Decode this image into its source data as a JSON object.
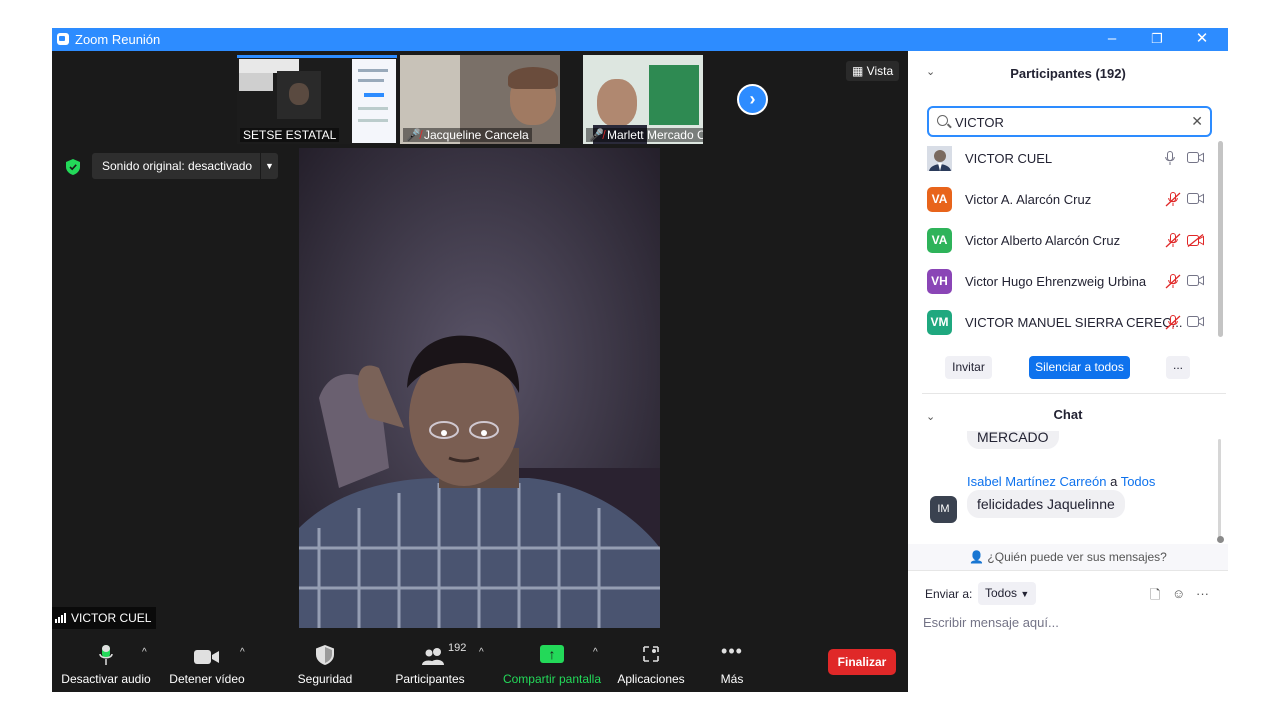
{
  "window": {
    "title": "Zoom Reunión",
    "controls": {
      "minimize": "–",
      "restore": "❐",
      "close": "✕"
    }
  },
  "thumbnails": [
    {
      "name": "SETSE ESTATAL",
      "muted": false
    },
    {
      "name": "Jacqueline Cancela",
      "muted": true
    },
    {
      "name": "Marlett Mercado Cruz",
      "muted": true
    }
  ],
  "view_button": "Vista",
  "original_sound": "Sonido original: desactivado",
  "active_speaker": "VICTOR CUEL",
  "toolbar": {
    "mute_audio": "Desactivar audio",
    "stop_video": "Detener vídeo",
    "security": "Seguridad",
    "participants": "Participantes",
    "participants_count": "192",
    "share_screen": "Compartir pantalla",
    "apps": "Aplicaciones",
    "more": "Más",
    "end": "Finalizar"
  },
  "participants_panel": {
    "title": "Participantes (192)",
    "search_value": "VICTOR",
    "list": [
      {
        "initials": "",
        "name": "VICTOR CUEL",
        "avatar_color": "#6e7a86",
        "mic": "on",
        "video": "on"
      },
      {
        "initials": "VA",
        "name": "Victor A. Alarcón Cruz",
        "avatar_color": "#e8641b",
        "mic": "muted",
        "video": "on"
      },
      {
        "initials": "VA",
        "name": "Victor Alberto Alarcón Cruz",
        "avatar_color": "#2eb35a",
        "mic": "muted",
        "video": "off"
      },
      {
        "initials": "VH",
        "name": "Victor Hugo Ehrenzweig Urbina",
        "avatar_color": "#8a45b6",
        "mic": "muted",
        "video": "on"
      },
      {
        "initials": "VM",
        "name": "VICTOR MANUEL SIERRA CEREC...",
        "avatar_color": "#1fa87f",
        "mic": "muted",
        "video": "on"
      }
    ],
    "invite": "Invitar",
    "mute_all": "Silenciar a todos",
    "more": "..."
  },
  "chat": {
    "title": "Chat",
    "messages": [
      {
        "text": "MERCADO"
      },
      {
        "sender": "Isabel Martínez Carreón",
        "connector": "a",
        "recipient": "Todos",
        "initials": "IM",
        "text": "felicidades Jaquelinne"
      }
    ],
    "who_sees": "¿Quién puede ver sus mensajes?",
    "send_to_label": "Enviar a:",
    "send_to_value": "Todos",
    "placeholder": "Escribir mensaje aquí...",
    "more": "···"
  },
  "colors": {
    "zoom_blue": "#2d8cff",
    "end_red": "#e02828",
    "muted_red": "#e02828",
    "share_green": "#23d959",
    "meeting_bg": "#1a1a1a"
  }
}
